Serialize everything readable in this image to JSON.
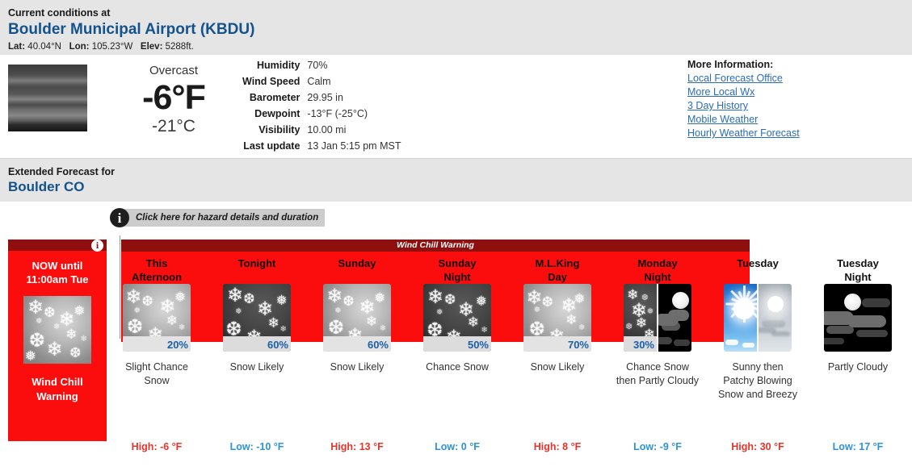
{
  "current": {
    "heading": "Current conditions at",
    "station": "Boulder Municipal Airport (KBDU)",
    "lat_label": "Lat:",
    "lat_value": "40.04°N",
    "lon_label": "Lon:",
    "lon_value": "105.23°W",
    "elev_label": "Elev:",
    "elev_value": "5288ft.",
    "condition": "Overcast",
    "temp_f": "-6°F",
    "temp_c": "-21°C",
    "details": [
      {
        "key": "Humidity",
        "value": "70%"
      },
      {
        "key": "Wind Speed",
        "value": "Calm"
      },
      {
        "key": "Barometer",
        "value": "29.95 in"
      },
      {
        "key": "Dewpoint",
        "value": "-13°F (-25°C)"
      },
      {
        "key": "Visibility",
        "value": "10.00 mi"
      },
      {
        "key": "Last update",
        "value": "13 Jan 5:15 pm MST"
      }
    ]
  },
  "more_information": {
    "title": "More Information:",
    "links": [
      "Local Forecast Office",
      "More Local Wx",
      "3 Day History",
      "Mobile Weather",
      "Hourly Weather Forecast"
    ]
  },
  "extended": {
    "heading": "Extended Forecast for",
    "location": "Boulder CO"
  },
  "hazard": {
    "tooltip": "Click here for hazard details and duration",
    "info_glyph": "i",
    "banner": "Wind Chill Warning",
    "now": {
      "time_line1": "NOW until",
      "time_line2": "11:00am Tue",
      "description_line1": "Wind Chill",
      "description_line2": "Warning",
      "icon": "snow-icon"
    }
  },
  "forecast": {
    "periods": [
      {
        "name_line1": "This",
        "name_line2": "Afternoon",
        "icon": "snow-day-icon",
        "pop": "20%",
        "description": "Slight Chance Snow",
        "temp_label": "High: -6 °F",
        "temp_type": "high"
      },
      {
        "name_line1": "Tonight",
        "name_line2": "",
        "icon": "snow-night-icon",
        "pop": "60%",
        "description": "Snow Likely",
        "temp_label": "Low: -10 °F",
        "temp_type": "low"
      },
      {
        "name_line1": "Sunday",
        "name_line2": "",
        "icon": "snow-day-icon",
        "pop": "60%",
        "description": "Snow Likely",
        "temp_label": "High: 13 °F",
        "temp_type": "high"
      },
      {
        "name_line1": "Sunday",
        "name_line2": "Night",
        "icon": "snow-night-icon",
        "pop": "50%",
        "description": "Chance Snow",
        "temp_label": "Low: 0 °F",
        "temp_type": "low"
      },
      {
        "name_line1": "M.L.King",
        "name_line2": "Day",
        "icon": "snow-day-icon",
        "pop": "70%",
        "description": "Snow Likely",
        "temp_label": "High: 8 °F",
        "temp_type": "high"
      },
      {
        "name_line1": "Monday",
        "name_line2": "Night",
        "icon": "snow-then-partly-cloudy-night-icon",
        "pop": "30%",
        "description": "Chance Snow then Partly Cloudy",
        "temp_label": "Low: -9 °F",
        "temp_type": "low"
      },
      {
        "name_line1": "Tuesday",
        "name_line2": "",
        "icon": "sunny-then-blowing-snow-icon",
        "pop": "",
        "description": "Sunny then Patchy Blowing Snow and Breezy",
        "temp_label": "High: 30 °F",
        "temp_type": "high"
      },
      {
        "name_line1": "Tuesday",
        "name_line2": "Night",
        "icon": "partly-cloudy-night-icon",
        "pop": "",
        "description": "Partly Cloudy",
        "temp_label": "Low: 17 °F",
        "temp_type": "low"
      }
    ]
  },
  "colors": {
    "hazard_red": "#fb0d0d",
    "hazard_dark_red": "#8f0f0f",
    "link_blue": "#2b6cb7",
    "title_blue": "#14528c",
    "high_red": "#e8332a",
    "low_blue": "#2c93d8",
    "pop_blue": "#1b5fa6",
    "band_gray": "#e5e5e5"
  }
}
